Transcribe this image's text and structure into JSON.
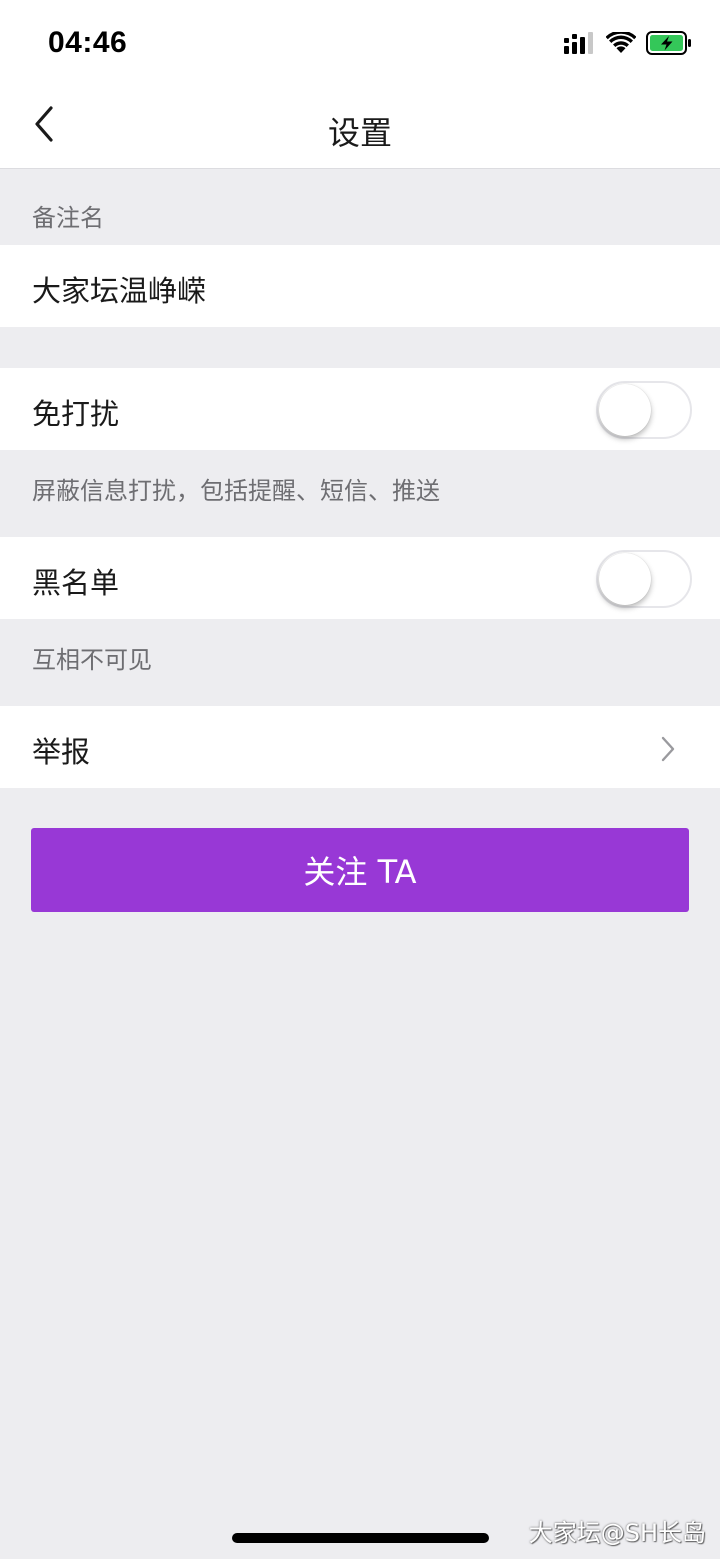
{
  "status_bar": {
    "time": "04:46",
    "signal_icon": "cellular-signal-icon",
    "wifi_icon": "wifi-icon",
    "battery_icon": "battery-charging-icon",
    "battery_color": "#34c759"
  },
  "nav": {
    "title": "设置",
    "back_icon": "chevron-left-icon"
  },
  "remark": {
    "section_label": "备注名",
    "value": "大家坛温峥嵘"
  },
  "do_not_disturb": {
    "label": "免打扰",
    "enabled": false,
    "description": "屏蔽信息打扰，包括提醒、短信、推送"
  },
  "blacklist": {
    "label": "黑名单",
    "enabled": false,
    "description": "互相不可见"
  },
  "report": {
    "label": "举报",
    "chevron_icon": "chevron-right-icon"
  },
  "follow_button": {
    "label": "关注 TA",
    "color": "#9838d6"
  },
  "watermark": "大家坛@SH长岛"
}
